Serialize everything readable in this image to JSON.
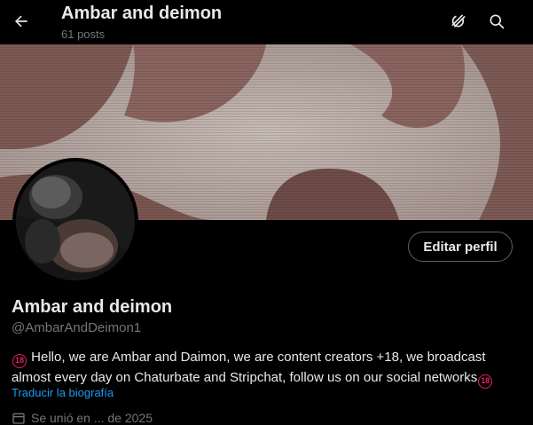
{
  "header": {
    "title": "Ambar and deimon",
    "post_count": "61 posts",
    "icons": {
      "back": "arrow-left-icon",
      "grok": "grok-icon",
      "search": "search-icon"
    }
  },
  "banner": {
    "description": "banner-image"
  },
  "profile": {
    "avatar": "avatar-photo",
    "edit_label": "Editar perfil",
    "name": "Ambar and deimon",
    "handle": "@AmbarAndDeimon1",
    "bio_emoji": "🔞",
    "bio_text": "Hello, we are Ambar and Daimon, we are content creators +18, we broadcast almost every day on Chaturbate and Stripchat, follow us on our social networks",
    "translate_label": "Traducir la biografía",
    "joined_text": "Se unió en ... de 2025"
  },
  "colors": {
    "background": "#000000",
    "text": "#e7e9ea",
    "muted": "#71767b",
    "link": "#1d9bf0",
    "border": "#536471"
  }
}
